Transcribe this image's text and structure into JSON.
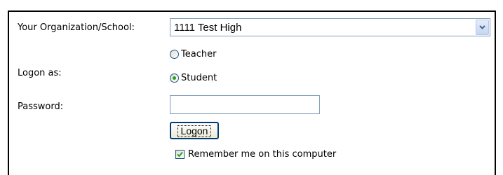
{
  "form": {
    "organization": {
      "label": "Your Organization/School:",
      "selected_value": "1111 Test High",
      "dropdown_icon": "chevron-down-icon"
    },
    "logon_as": {
      "label": "Logon as:",
      "options": [
        {
          "label": "Teacher",
          "selected": false
        },
        {
          "label": "Student",
          "selected": true
        }
      ]
    },
    "password": {
      "label": "Password:",
      "value": "",
      "placeholder": ""
    },
    "logon_button": {
      "label": "Logon"
    },
    "remember_me": {
      "label": "Remember me on this computer",
      "checked": true
    }
  },
  "colors": {
    "border": "#000000",
    "input_border": "#7f9db9",
    "radio_selected": "#21a121",
    "checkbox_check": "#21a121",
    "button_border": "#003c74"
  }
}
